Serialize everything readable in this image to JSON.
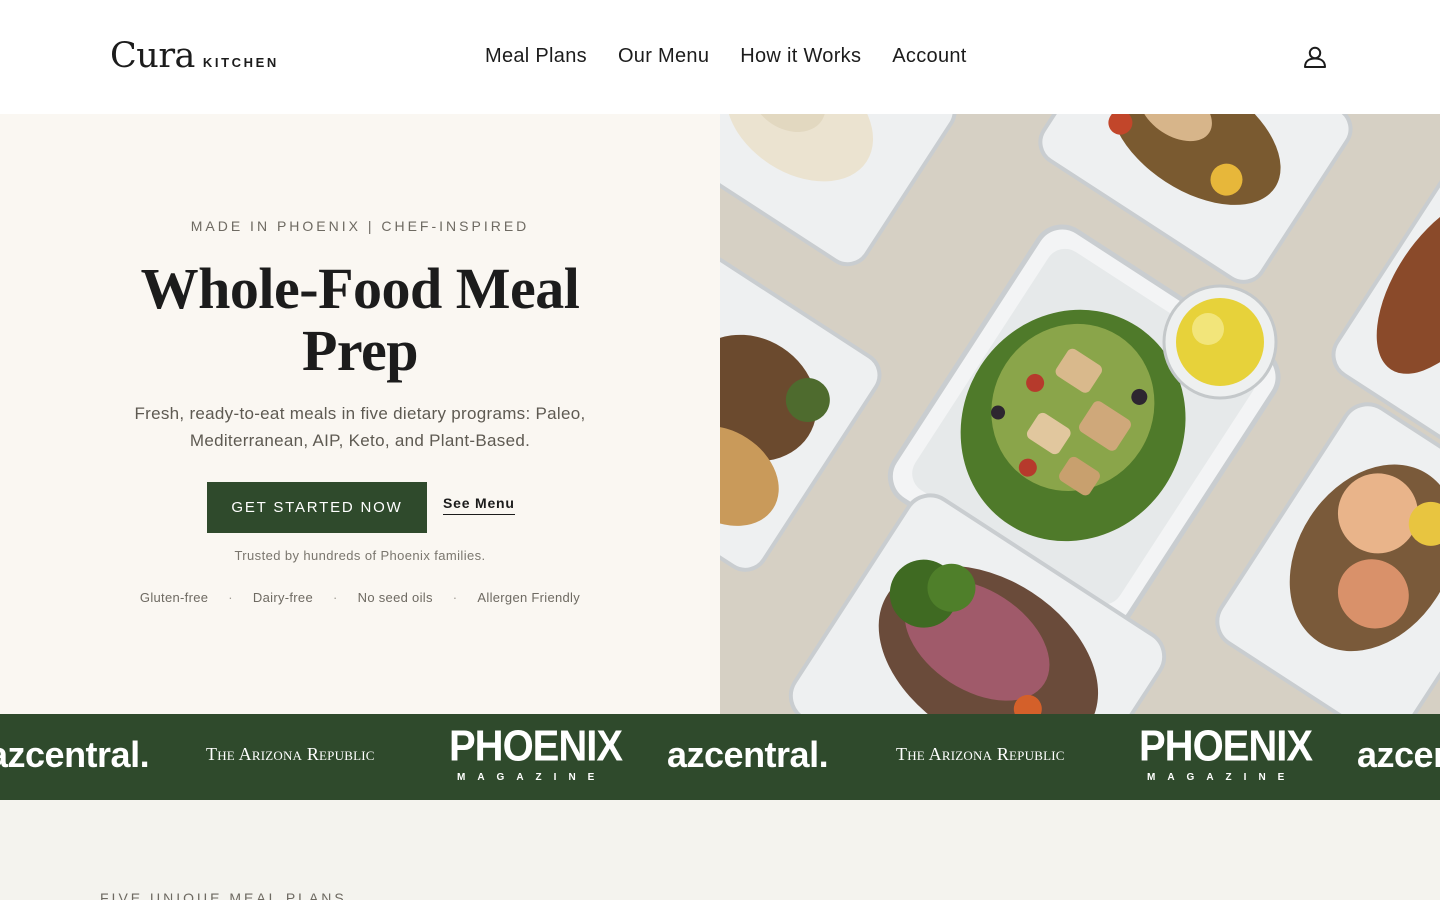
{
  "header": {
    "logo_main": "Cura",
    "logo_sub": "KITCHEN",
    "nav": [
      {
        "label": "Meal Plans"
      },
      {
        "label": "Our Menu"
      },
      {
        "label": "How it Works"
      },
      {
        "label": "Account"
      }
    ],
    "account_icon": "user-icon"
  },
  "hero": {
    "eyebrow": "MADE IN PHOENIX | CHEF-INSPIRED",
    "title": "Whole-Food Meal Prep",
    "description": "Fresh, ready-to-eat meals in five dietary programs: Paleo, Mediterranean, AIP, Keto, and Plant-Based.",
    "cta_label": "GET STARTED NOW",
    "menu_link": "See Menu",
    "trust": "Trusted by hundreds of Phoenix families.",
    "features": [
      "Gluten-free",
      "Dairy-free",
      "No seed oils",
      "Allergen Friendly"
    ],
    "feature_separator": "·"
  },
  "press": {
    "azcentral": "azcentral.",
    "arizona_republic": "The Arizona Republic",
    "phoenix_main": "PHOENIX",
    "phoenix_sub": "MAGAZINE"
  },
  "section": {
    "eyebrow": "FIVE UNIQUE MEAL PLANS"
  },
  "colors": {
    "accent": "#2f4a2c",
    "hero_bg": "#faf7f2",
    "page_bg": "#f4f3ee"
  }
}
